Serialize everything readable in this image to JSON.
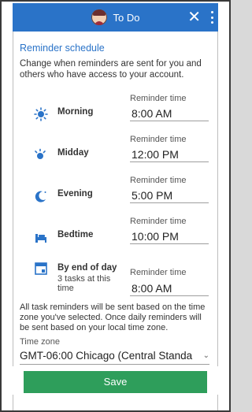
{
  "header": {
    "title": "To Do",
    "close_icon": "close-icon",
    "more_icon": "more-vertical-icon",
    "color": "#2a73c8"
  },
  "reminder": {
    "section_title": "Reminder schedule",
    "intro": "Change when reminders are sent for you and others who have access to your account.",
    "rows": [
      {
        "name": "Morning",
        "icon": "sun-icon",
        "time_label": "Reminder time",
        "time": "8:00 AM"
      },
      {
        "name": "Midday",
        "icon": "midday-sun-icon",
        "time_label": "Reminder time",
        "time": "12:00 PM"
      },
      {
        "name": "Evening",
        "icon": "moon-icon",
        "time_label": "Reminder time",
        "time": "5:00 PM"
      },
      {
        "name": "Bedtime",
        "icon": "bed-icon",
        "time_label": "Reminder time",
        "time": "10:00 PM"
      },
      {
        "name": "By end of day",
        "sub": "3 tasks at this time",
        "icon": "calendar-icon",
        "time_label": "Reminder time",
        "time": "8:00 AM"
      }
    ],
    "note": "All task reminders will be sent based on the time zone you've selected. Once daily reminders will be sent based on your local time zone.",
    "timezone_label": "Time zone",
    "timezone_value": "GMT-06:00 Chicago (Central Standa"
  },
  "save_label": "Save",
  "save_color": "#2e9e5b"
}
